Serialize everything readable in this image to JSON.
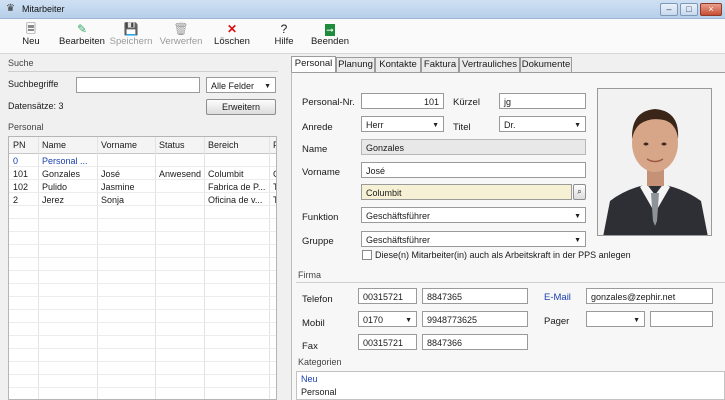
{
  "window": {
    "title": "Mitarbeiter"
  },
  "toolbar": {
    "new": "Neu",
    "edit": "Bearbeiten",
    "save": "Speichern",
    "discard": "Verwerfen",
    "delete": "Löschen",
    "help": "Hilfe",
    "exit": "Beenden"
  },
  "search": {
    "section": "Suche",
    "keywords_label": "Suchbegriffe",
    "keywords_value": "",
    "field_select": "Alle Felder",
    "records_label": "Datensätze: 3",
    "extend_button": "Erweitern"
  },
  "personnel_list": {
    "section": "Personal",
    "columns": [
      "PN",
      "Name",
      "Vorname",
      "Status",
      "Bereich",
      "F"
    ],
    "rows": [
      {
        "pn": "0",
        "name": "Personal ...",
        "vorname": "",
        "status": "",
        "bereich": "",
        "f": ""
      },
      {
        "pn": "101",
        "name": "Gonzales",
        "vorname": "José",
        "status": "Anwesend",
        "bereich": "Columbit",
        "f": "G"
      },
      {
        "pn": "102",
        "name": "Pulido",
        "vorname": "Jasmine",
        "status": "",
        "bereich": "Fabrica de P...",
        "f": "T"
      },
      {
        "pn": "2",
        "name": "Jerez",
        "vorname": "Sonja",
        "status": "",
        "bereich": "Oficina de v...",
        "f": "T"
      }
    ]
  },
  "tabs": [
    "Personal",
    "Planung",
    "Kontakte",
    "Faktura",
    "Vertrauliches",
    "Dokumente"
  ],
  "form": {
    "personal_nr_label": "Personal-Nr.",
    "personal_nr": "101",
    "kuerzel_label": "Kürzel",
    "kuerzel": "jg",
    "anrede_label": "Anrede",
    "anrede": "Herr",
    "titel_label": "Titel",
    "titel": "Dr.",
    "name_label": "Name",
    "name": "Gonzales",
    "vorname_label": "Vorname",
    "vorname": "José",
    "bereich": "Columbit",
    "funktion_label": "Funktion",
    "funktion": "Geschäftsführer",
    "gruppe_label": "Gruppe",
    "gruppe": "Geschäftsführer",
    "pps_checkbox_label": "Diese(n) Mitarbeiter(in) auch als Arbeitskraft in der PPS anlegen"
  },
  "firma": {
    "section": "Firma",
    "telefon_label": "Telefon",
    "telefon_prefix": "00315721",
    "telefon_number": "8847365",
    "email_label": "E-Mail",
    "email": "gonzales@zephir.net",
    "mobil_label": "Mobil",
    "mobil_prefix": "0170",
    "mobil_number": "9948773625",
    "pager_label": "Pager",
    "pager_prefix": "",
    "pager_number": "",
    "fax_label": "Fax",
    "fax_prefix": "00315721",
    "fax_number": "8847366"
  },
  "kategorien": {
    "section": "Kategorien",
    "items": [
      "Neu",
      "Personal"
    ]
  },
  "colors": {
    "accent_blue": "#1a3fb0",
    "titlebar": "#c4d8ef",
    "close": "#c94d34"
  }
}
